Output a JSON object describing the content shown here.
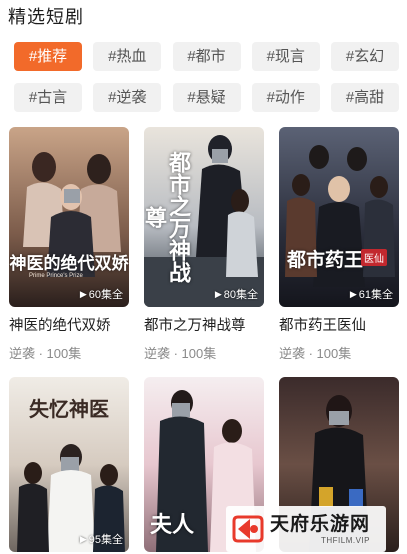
{
  "section": {
    "title": "精选短剧"
  },
  "tags": [
    [
      {
        "label": "#推荐",
        "active": true
      },
      {
        "label": "#热血",
        "active": false
      },
      {
        "label": "#都市",
        "active": false
      },
      {
        "label": "#现言",
        "active": false
      },
      {
        "label": "#玄幻",
        "active": false
      }
    ],
    [
      {
        "label": "#古言",
        "active": false
      },
      {
        "label": "#逆袭",
        "active": false
      },
      {
        "label": "#悬疑",
        "active": false
      },
      {
        "label": "#动作",
        "active": false
      },
      {
        "label": "#高甜",
        "active": false
      }
    ]
  ],
  "dramas": [
    {
      "title": "神医的绝代双娇",
      "meta": "逆袭 · 100集",
      "episodes": "60集全",
      "poster_text": "神医的绝代双娇",
      "poster_subtext": "Prime Prince's Prize",
      "accent": "#b98a6a"
    },
    {
      "title": "都市之万神战尊",
      "meta": "逆袭 · 100集",
      "episodes": "80集全",
      "poster_text": "都市之万神战尊",
      "accent": "#7a8fa8"
    },
    {
      "title": "都市药王医仙",
      "meta": "逆袭 · 100集",
      "episodes": "61集全",
      "poster_text": "都市药王",
      "poster_badge": "医仙",
      "accent": "#3b3f56"
    },
    {
      "title": "",
      "meta": "",
      "episodes": "95集全",
      "poster_text": "失忆神医",
      "accent": "#d9d0c8"
    },
    {
      "title": "",
      "meta": "",
      "episodes": "",
      "poster_text": "夫人",
      "accent": "#e6c8cf"
    },
    {
      "title": "",
      "meta": "",
      "episodes": "",
      "poster_text": "",
      "accent": "#4a3a3a"
    }
  ],
  "watermark": {
    "name": "天府乐游网",
    "url": "THFILM.VIP"
  },
  "icons": {
    "play": "play-icon",
    "logo": "tianfu-logo-icon"
  }
}
